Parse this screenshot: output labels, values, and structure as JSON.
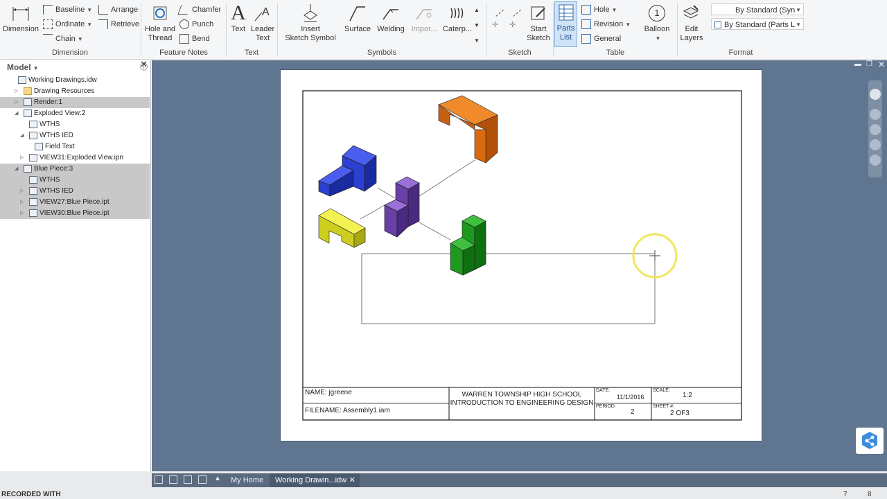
{
  "ribbon": {
    "groups": {
      "dimension": "Dimension",
      "feature_notes": "Feature Notes",
      "text": "Text",
      "symbols": "Symbols",
      "sketch": "Sketch",
      "table": "Table",
      "format": "Format"
    },
    "dimension_btn": "Dimension",
    "baseline": "Baseline",
    "ordinate": "Ordinate",
    "chain": "Chain",
    "arrange": "Arrange",
    "retrieve": "Retrieve",
    "hole_thread": [
      "Hole and",
      "Thread"
    ],
    "chamfer": "Chamfer",
    "punch": "Punch",
    "bend": "Bend",
    "text_btn": "Text",
    "leader_text": [
      "Leader",
      "Text"
    ],
    "insert_sketch_symbol": [
      "Insert",
      "Sketch Symbol"
    ],
    "surface": "Surface",
    "welding": "Welding",
    "import": "Impor...",
    "caterpillar": "Caterp...",
    "start_sketch": [
      "Start",
      "Sketch"
    ],
    "parts_list": [
      "Parts",
      "List"
    ],
    "hole": "Hole",
    "revision": "Revision",
    "general": "General",
    "balloon": "Balloon",
    "edit_layers": [
      "Edit",
      "Layers"
    ],
    "style1": "By Standard (Syn",
    "style2": "By Standard (Parts L",
    "balloon_num": "1",
    "text_glyph": "A"
  },
  "browser": {
    "title": "Model",
    "items": [
      {
        "label": "Working Drawings.idw",
        "level": 0,
        "selected": false,
        "expander": ""
      },
      {
        "label": "Drawing Resources",
        "level": 1,
        "selected": false,
        "expander": "▷"
      },
      {
        "label": "Render:1",
        "level": 1,
        "selected": true,
        "expander": "▷"
      },
      {
        "label": "Exploded View:2",
        "level": 1,
        "selected": false,
        "expander": "◢"
      },
      {
        "label": "WTHS",
        "level": 2,
        "selected": false,
        "expander": ""
      },
      {
        "label": "WTHS IED",
        "level": 2,
        "selected": false,
        "expander": "◢"
      },
      {
        "label": "Field Text",
        "level": 3,
        "selected": false,
        "expander": ""
      },
      {
        "label": "VIEW31:Exploded View.ipn",
        "level": 2,
        "selected": false,
        "expander": "▷"
      },
      {
        "label": "Blue Piece:3",
        "level": 1,
        "selected": true,
        "expander": "◢"
      },
      {
        "label": "WTHS",
        "level": 2,
        "selected": true,
        "expander": ""
      },
      {
        "label": "WTHS IED",
        "level": 2,
        "selected": true,
        "expander": "▷"
      },
      {
        "label": "VIEW27:Blue Piece.ipt",
        "level": 2,
        "selected": true,
        "expander": "▷"
      },
      {
        "label": "VIEW30:Blue Piece.ipt",
        "level": 2,
        "selected": true,
        "expander": "▷"
      }
    ]
  },
  "title_block": {
    "name": "NAME: jgreene",
    "filename": "FILENAME: Assembly1.iam",
    "school": "WARREN TOWNSHIP HIGH SCHOOL",
    "course": "INTRODUCTION TO ENGINEERING DESIGN",
    "date_label": "DATE:",
    "date_value": "11/1/2016",
    "scale_label": "SCALE:",
    "scale_value": "1:2",
    "period_label": "PERIOD:",
    "period_value": "2",
    "sheet_label": "SHEET #:",
    "sheet_value": "2 OF3"
  },
  "tabs": {
    "home": "My Home",
    "doc": "Working Drawin...idw"
  },
  "status": {
    "left": "RECORDED WITH",
    "num1": "7",
    "num2": "8"
  },
  "colors": {
    "canvas": "#5f7590",
    "orange": "#d96a10",
    "blue": "#2b3fd0",
    "purple": "#6a3fa8",
    "yellow": "#dede30",
    "green": "#1d9a1d",
    "cursor": "#f0e040"
  }
}
